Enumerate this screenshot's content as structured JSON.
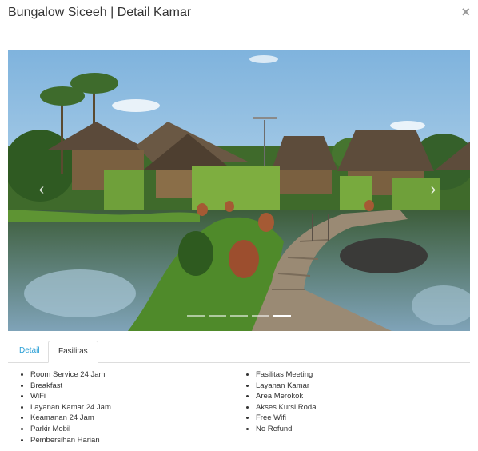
{
  "modal": {
    "title": "Bungalow Siceeh | Detail Kamar",
    "close_label": "×"
  },
  "carousel": {
    "prev_label": "‹",
    "next_label": "›",
    "slides": 5,
    "active_slide": 5
  },
  "tabs": [
    {
      "label": "Detail",
      "active": false
    },
    {
      "label": "Fasilitas",
      "active": true
    }
  ],
  "facilities": {
    "column1": [
      "Room Service 24 Jam",
      "Breakfast",
      "WiFi",
      "Layanan Kamar 24 Jam",
      "Keamanan 24 Jam",
      "Parkir Mobil",
      "Pembersihan Harian"
    ],
    "column2": [
      "Fasilitas Meeting",
      "Layanan Kamar",
      "Area Merokok",
      "Akses Kursi Roda",
      "Free Wifi",
      "No Refund"
    ]
  },
  "colors": {
    "tab_link": "#2a9fd6",
    "border": "#dddddd"
  }
}
